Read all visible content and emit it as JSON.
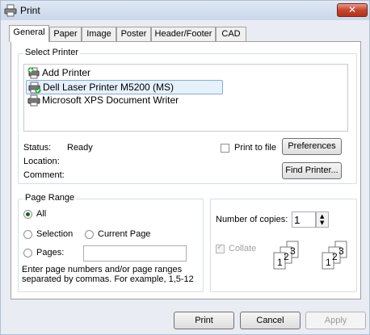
{
  "window": {
    "title": "Print",
    "close_symbol": "✕"
  },
  "tabs": [
    "General",
    "Paper",
    "Image",
    "Poster",
    "Header/Footer",
    "CAD"
  ],
  "select_printer": {
    "group_label": "Select Printer",
    "printers": [
      "Add Printer",
      "Dell Laser Printer M5200 (MS)",
      "Microsoft XPS Document Writer"
    ],
    "selected_index": 1,
    "status_label": "Status:",
    "status_value": "Ready",
    "location_label": "Location:",
    "comment_label": "Comment:",
    "print_to_file_label": "Print to file",
    "preferences_label": "Preferences",
    "find_printer_label": "Find Printer..."
  },
  "page_range": {
    "group_label": "Page Range",
    "options": [
      "All",
      "Selection",
      "Current Page",
      "Pages:"
    ],
    "selected": "All",
    "pages_value": "",
    "hint": "Enter page numbers and/or page ranges separated by commas.  For example, 1,5-12"
  },
  "copies": {
    "label": "Number of copies:",
    "value": "1",
    "collate_label": "Collate",
    "collate_checked": true,
    "collate_enabled": false,
    "sheet_numbers": [
      "1",
      "2",
      "3"
    ]
  },
  "footer": {
    "print": "Print",
    "cancel": "Cancel",
    "apply": "Apply"
  }
}
